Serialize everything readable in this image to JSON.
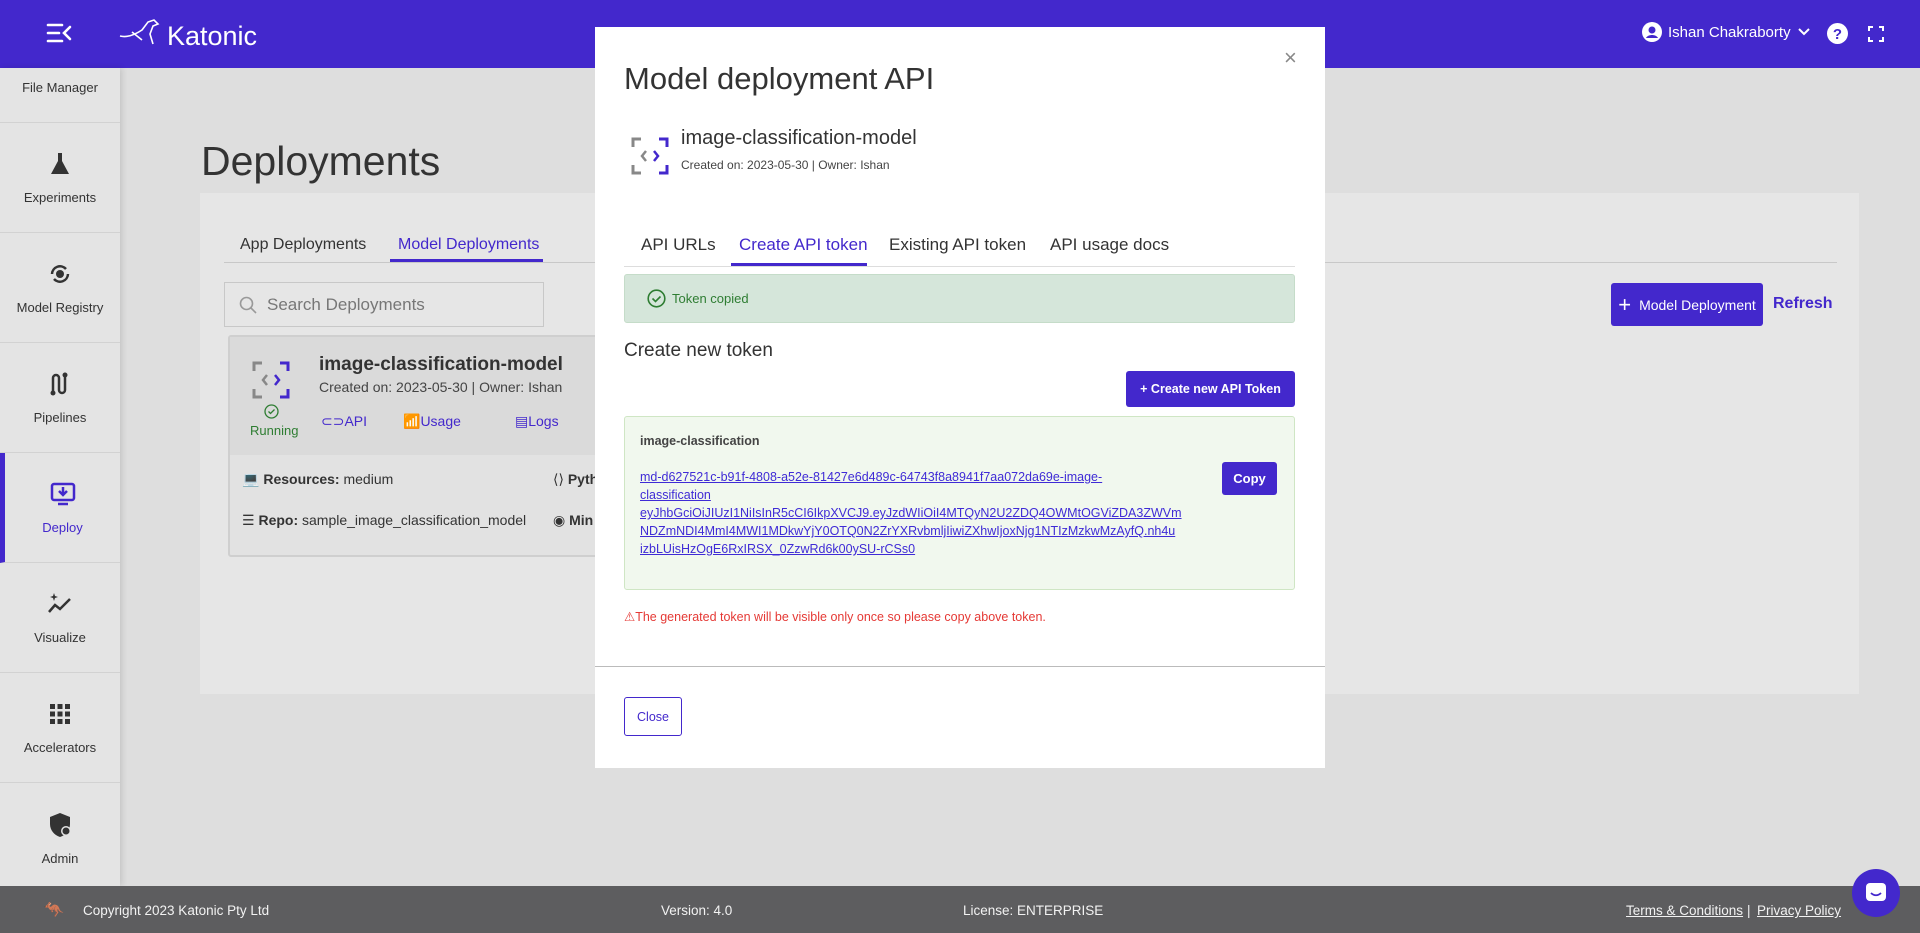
{
  "header": {
    "brand": "Katonic",
    "user": "Ishan Chakraborty",
    "bg": "#4328cc"
  },
  "sidebar": {
    "items": [
      {
        "label": "File Manager",
        "icon": "folder-icon"
      },
      {
        "label": "Experiments",
        "icon": "flask-icon"
      },
      {
        "label": "Model Registry",
        "icon": "model-registry-icon"
      },
      {
        "label": "Pipelines",
        "icon": "pipeline-icon"
      },
      {
        "label": "Deploy",
        "icon": "deploy-icon",
        "active": true
      },
      {
        "label": "Visualize",
        "icon": "visualize-icon"
      },
      {
        "label": "Accelerators",
        "icon": "grid-icon"
      },
      {
        "label": "Admin",
        "icon": "admin-shield-icon"
      }
    ]
  },
  "page": {
    "title": "Deployments",
    "tabs": [
      "App Deployments",
      "Model Deployments"
    ],
    "active_tab": 1,
    "search_placeholder": "Search Deployments",
    "add_button": "Model Deployment",
    "refresh": "Refresh"
  },
  "card": {
    "name": "image-classification-model",
    "meta": "Created on: 2023-05-30 | Owner: Ishan",
    "status": "Running",
    "links": [
      "API",
      "Usage",
      "Logs"
    ],
    "resources_label": "Resources:",
    "resources": "medium",
    "repo_label": "Repo:",
    "repo": "sample_image_classification_model",
    "python_partial": "Pyth",
    "min_partial": "Min"
  },
  "modal": {
    "title": "Model deployment API",
    "model_name": "image-classification-model",
    "meta": "Created on: 2023-05-30 | Owner: Ishan",
    "tabs": [
      "API URLs",
      "Create API token",
      "Existing API token",
      "API usage docs"
    ],
    "active_tab": 1,
    "alert": "Token copied",
    "section_title": "Create new token",
    "create_button": "+ Create new API Token",
    "token_name": "image-classification",
    "token_lines": [
      "md-d627521c-b91f-4808-a52e-81427e6d489c-64743f8a8941f7aa072da69e-image-",
      "classification",
      "eyJhbGciOiJIUzI1NiIsInR5cCI6IkpXVCJ9.eyJzdWIiOiI4MTQyN2U2ZDQ4OWMtOGViZDA3ZWVm",
      "NDZmNDI4MmI4MWI1MDkwYjY0OTQ0N2ZrYXRvbmljIiwiZXhwIjoxNjg1NTIzMzkwMzAyfQ.nh4u",
      "izbLUisHzOgE6RxIRSX_0ZzwRd6k00ySU-rCSs0"
    ],
    "copy_button": "Copy",
    "warning": "⚠The generated token will be visible only once so please copy above token.",
    "close_button": "Close"
  },
  "footer": {
    "copyright": "Copyright 2023 Katonic Pty Ltd",
    "version": "Version: 4.0",
    "license": "License: ENTERPRISE",
    "terms": "Terms & Conditions",
    "sep": "|",
    "privacy": "Privacy Policy"
  }
}
